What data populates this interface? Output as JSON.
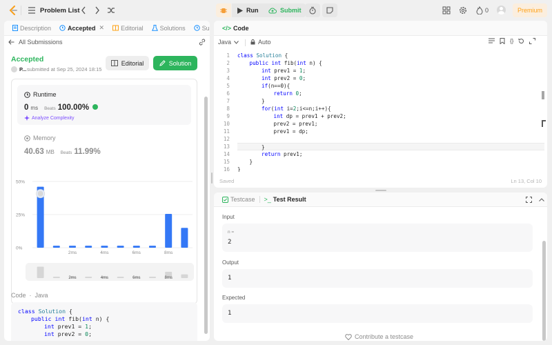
{
  "topbar": {
    "problem_list": "Problem List",
    "run": "Run",
    "submit": "Submit",
    "streak": "0",
    "premium": "Premium"
  },
  "left_tabs": [
    {
      "label": "Description"
    },
    {
      "label": "Accepted"
    },
    {
      "label": "Editorial"
    },
    {
      "label": "Solutions"
    },
    {
      "label": "Subm"
    }
  ],
  "back": {
    "label": "All Submissions"
  },
  "submission": {
    "status": "Accepted",
    "user": "P...",
    "submitted": "submitted at Sep 25, 2024 18:15",
    "editorial_btn": "Editorial",
    "solution_btn": "Solution"
  },
  "runtime": {
    "title": "Runtime",
    "value": "0",
    "unit": "ms",
    "beats_label": "Beats",
    "beats": "100.00%",
    "analyze": "Analyze Complexity"
  },
  "memory": {
    "title": "Memory",
    "value": "40.63",
    "unit": "MB",
    "beats_label": "Beats",
    "beats": "11.99%"
  },
  "chart_data": {
    "type": "bar",
    "ytick_labels": [
      "50%",
      "25%",
      "0%"
    ],
    "ylim": [
      0,
      50
    ],
    "xtick_labels": [
      "2ms",
      "4ms",
      "6ms",
      "8ms"
    ],
    "values": [
      46,
      1.5,
      1.5,
      1.5,
      1.5,
      1.5,
      1.5,
      1.5,
      25.5,
      15
    ],
    "highlight_index": 0,
    "color": "#3478f6"
  },
  "code_preview": {
    "label": "Code",
    "lang": "Java"
  },
  "editor": {
    "title": "Code",
    "lang": "Java",
    "mode": "Auto",
    "status": "Saved",
    "cursor": "Ln 13, Col 10"
  },
  "code_lines": [
    {
      "n": "1",
      "indent": 0,
      "text": "class Solution {"
    },
    {
      "n": "2",
      "indent": 1,
      "text": "public int fib(int n) {"
    },
    {
      "n": "3",
      "indent": 2,
      "text": "int prev1 = 1;"
    },
    {
      "n": "4",
      "indent": 2,
      "text": "int prev2 = 0;"
    },
    {
      "n": "5",
      "indent": 2,
      "text": "if(n==0){"
    },
    {
      "n": "6",
      "indent": 3,
      "text": "return 0;"
    },
    {
      "n": "7",
      "indent": 2,
      "text": "}"
    },
    {
      "n": "8",
      "indent": 2,
      "text": "for(int i=2;i<=n;i++){"
    },
    {
      "n": "9",
      "indent": 3,
      "text": "int dp = prev1 + prev2;"
    },
    {
      "n": "10",
      "indent": 3,
      "text": "prev2 = prev1;"
    },
    {
      "n": "11",
      "indent": 3,
      "text": "prev1 = dp;"
    },
    {
      "n": "12",
      "indent": 3,
      "text": ""
    },
    {
      "n": "13",
      "indent": 2,
      "text": "}"
    },
    {
      "n": "14",
      "indent": 2,
      "text": "return prev1;"
    },
    {
      "n": "15",
      "indent": 1,
      "text": "}"
    },
    {
      "n": "16",
      "indent": 0,
      "text": "}"
    }
  ],
  "preview_lines": [
    {
      "indent": 0,
      "text": "class Solution {"
    },
    {
      "indent": 1,
      "text": "public int fib(int n) {"
    },
    {
      "indent": 2,
      "text": "int prev1 = 1;"
    },
    {
      "indent": 2,
      "text": "int prev2 = 0;"
    }
  ],
  "bottom_tabs": {
    "testcase": "Testcase",
    "result": "Test Result"
  },
  "result": {
    "input_label": "Input",
    "var": "n =",
    "input_value": "2",
    "output_label": "Output",
    "output_value": "1",
    "expected_label": "Expected",
    "expected_value": "1",
    "contribute": "Contribute a testcase"
  },
  "colors": {
    "accepted": "#2db55d",
    "accent": "#1890ff",
    "premium": "#ffa116",
    "bar": "#3478f6"
  }
}
